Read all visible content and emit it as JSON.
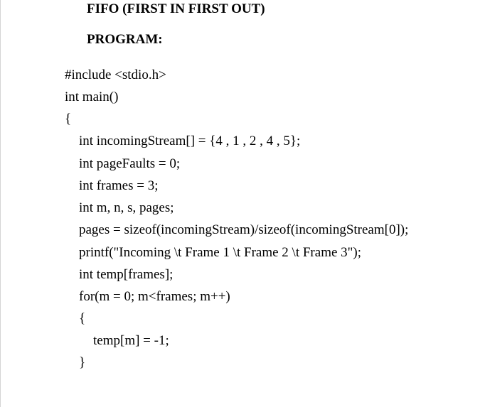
{
  "document": {
    "title": "FIFO (FIRST IN FIRST OUT)",
    "section_label": "PROGRAM:",
    "code_lines": [
      "#include <stdio.h>",
      "int main()",
      "{",
      "int incomingStream[] = {4 , 1 , 2 , 4 , 5};",
      "int pageFaults = 0;",
      "int frames = 3;",
      "int m, n, s, pages;",
      "pages = sizeof(incomingStream)/sizeof(incomingStream[0]);",
      "printf(\"Incoming \\t Frame 1 \\t Frame 2 \\t Frame 3\");",
      "int temp[frames];",
      "for(m = 0; m<frames; m++)",
      "{",
      "temp[m] = -1;",
      "}"
    ]
  }
}
